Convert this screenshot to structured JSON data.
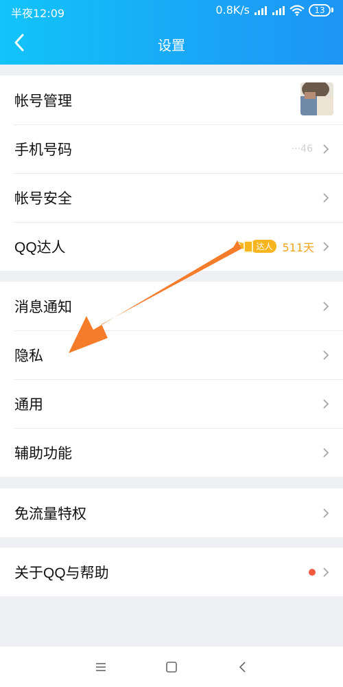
{
  "status_bar": {
    "time": "半夜12:09",
    "network_speed": "0.8K/s",
    "battery": "13"
  },
  "header": {
    "title": "设置"
  },
  "groups": [
    {
      "items": [
        {
          "label": "帐号管理"
        },
        {
          "label": "手机号码",
          "value": "···46"
        },
        {
          "label": "帐号安全"
        },
        {
          "label": "QQ达人",
          "badge": "达人",
          "days": "511天"
        }
      ]
    },
    {
      "items": [
        {
          "label": "消息通知"
        },
        {
          "label": "隐私"
        },
        {
          "label": "通用"
        },
        {
          "label": "辅助功能"
        }
      ]
    },
    {
      "items": [
        {
          "label": "免流量特权"
        }
      ]
    },
    {
      "items": [
        {
          "label": "关于QQ与帮助"
        }
      ]
    }
  ],
  "colors": {
    "header_start": "#12c4f9",
    "header_end": "#1d95f5",
    "badge": "#f7b51f",
    "days": "#f2a31c",
    "notification_dot": "#f25a40",
    "annotation_arrow": "#f57c2b"
  },
  "icons": {
    "back": "chevron-left-icon",
    "row_arrow": "chevron-right-icon",
    "nav_menu": "menu-icon",
    "nav_home": "square-icon",
    "nav_back": "triangle-left-icon"
  }
}
